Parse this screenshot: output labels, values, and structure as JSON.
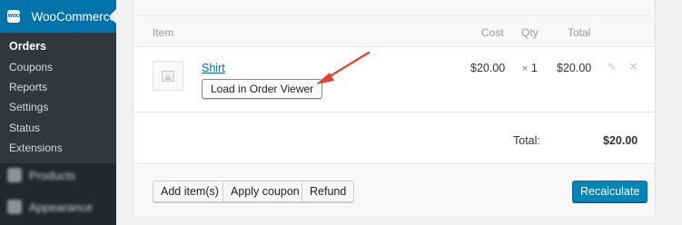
{
  "sidebar": {
    "plugin_title": "WooCommerce",
    "logo_text": "WOO",
    "items": [
      {
        "label": "Orders",
        "active": true
      },
      {
        "label": "Coupons"
      },
      {
        "label": "Reports"
      },
      {
        "label": "Settings"
      },
      {
        "label": "Status"
      },
      {
        "label": "Extensions"
      }
    ],
    "menu": [
      {
        "label": "Products",
        "icon": "products-icon"
      },
      {
        "label": "Appearance",
        "icon": "appearance-icon"
      }
    ]
  },
  "order_items": {
    "headers": {
      "item": "Item",
      "cost": "Cost",
      "qty": "Qty",
      "total": "Total"
    },
    "rows": [
      {
        "name": "Shirt",
        "cost": "$20.00",
        "qty_prefix": "×",
        "qty": "1",
        "total": "$20.00",
        "action_label": "Load in Order Viewer"
      }
    ],
    "totals": {
      "label": "Total:",
      "value": "$20.00"
    },
    "actions": {
      "add_items": "Add item(s)",
      "apply_coupon": "Apply coupon",
      "refund": "Refund",
      "recalculate": "Recalculate"
    }
  },
  "colors": {
    "accent": "#0073aa",
    "primary_button": "#0085ba",
    "annotation_arrow": "#e8402a",
    "sidebar_bg": "#23282d"
  }
}
